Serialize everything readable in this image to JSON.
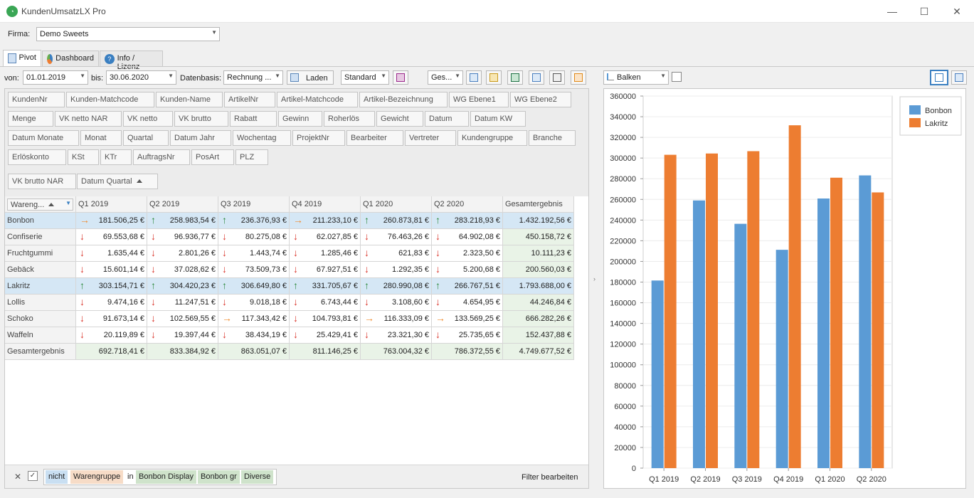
{
  "window": {
    "title": "KundenUmsatzLX Pro",
    "minimize": "—",
    "maximize": "☐",
    "close": "✕"
  },
  "firma": {
    "label": "Firma:",
    "value": "Demo Sweets"
  },
  "tabs": [
    {
      "label": "Pivot"
    },
    {
      "label": "Dashboard"
    },
    {
      "label": "Info / Lizenz"
    }
  ],
  "toolbar": {
    "von_label": "von:",
    "von_value": "01.01.2019",
    "bis_label": "bis:",
    "bis_value": "30.06.2020",
    "datenbasis_label": "Datenbasis:",
    "datenbasis_value": "Rechnung ...",
    "laden_label": "Laden",
    "layout_value": "Standard",
    "ges_value": "Ges..."
  },
  "field_buttons": [
    [
      "KundenNr",
      "Kunden-Matchcode",
      "Kunden-Name",
      "ArtikelNr",
      "Artikel-Matchcode",
      "Artikel-Bezeichnung",
      "WG Ebene1",
      "WG Ebene2"
    ],
    [
      "Menge",
      "VK netto NAR",
      "VK netto",
      "VK brutto",
      "Rabatt",
      "Gewinn",
      "Roherlös",
      "Gewicht",
      "Datum",
      "Datum KW"
    ],
    [
      "Datum Monate",
      "Monat",
      "Quartal",
      "Datum Jahr",
      "Wochentag",
      "ProjektNr",
      "Bearbeiter",
      "Vertreter",
      "Kundengruppe",
      "Branche"
    ],
    [
      "Erlöskonto",
      "KSt",
      "KTr",
      "AuftragsNr",
      "PosArt",
      "PLZ"
    ]
  ],
  "data_field": "VK brutto NAR",
  "column_field": "Datum Quartal",
  "row_field": "Wareng...",
  "grid": {
    "columns": [
      "Q1 2019",
      "Q2 2019",
      "Q3 2019",
      "Q4 2019",
      "Q1 2020",
      "Q2 2020",
      "Gesamtergebnis"
    ],
    "rows": [
      {
        "name": "Bonbon",
        "hl": true,
        "cells": [
          [
            "right",
            "181.506,25 €"
          ],
          [
            "up",
            "258.983,54 €"
          ],
          [
            "up",
            "236.376,93 €"
          ],
          [
            "right",
            "211.233,10 €"
          ],
          [
            "up",
            "260.873,81 €"
          ],
          [
            "up",
            "283.218,93 €"
          ]
        ],
        "total": "1.432.192,56 €"
      },
      {
        "name": "Confiserie",
        "hl": false,
        "cells": [
          [
            "down",
            "69.553,68 €"
          ],
          [
            "down",
            "96.936,77 €"
          ],
          [
            "down",
            "80.275,08 €"
          ],
          [
            "down",
            "62.027,85 €"
          ],
          [
            "down",
            "76.463,26 €"
          ],
          [
            "down",
            "64.902,08 €"
          ]
        ],
        "total": "450.158,72 €"
      },
      {
        "name": "Fruchtgummi",
        "hl": false,
        "cells": [
          [
            "down",
            "1.635,44 €"
          ],
          [
            "down",
            "2.801,26 €"
          ],
          [
            "down",
            "1.443,74 €"
          ],
          [
            "down",
            "1.285,46 €"
          ],
          [
            "down",
            "621,83 €"
          ],
          [
            "down",
            "2.323,50 €"
          ]
        ],
        "total": "10.111,23 €"
      },
      {
        "name": "Gebäck",
        "hl": false,
        "cells": [
          [
            "down",
            "15.601,14 €"
          ],
          [
            "down",
            "37.028,62 €"
          ],
          [
            "down",
            "73.509,73 €"
          ],
          [
            "down",
            "67.927,51 €"
          ],
          [
            "down",
            "1.292,35 €"
          ],
          [
            "down",
            "5.200,68 €"
          ]
        ],
        "total": "200.560,03 €"
      },
      {
        "name": "Lakritz",
        "hl": true,
        "cells": [
          [
            "up",
            "303.154,71 €"
          ],
          [
            "up",
            "304.420,23 €"
          ],
          [
            "up",
            "306.649,80 €"
          ],
          [
            "up",
            "331.705,67 €"
          ],
          [
            "up",
            "280.990,08 €"
          ],
          [
            "up",
            "266.767,51 €"
          ]
        ],
        "total": "1.793.688,00 €"
      },
      {
        "name": "Lollis",
        "hl": false,
        "cells": [
          [
            "down",
            "9.474,16 €"
          ],
          [
            "down",
            "11.247,51 €"
          ],
          [
            "down",
            "9.018,18 €"
          ],
          [
            "down",
            "6.743,44 €"
          ],
          [
            "down",
            "3.108,60 €"
          ],
          [
            "down",
            "4.654,95 €"
          ]
        ],
        "total": "44.246,84 €"
      },
      {
        "name": "Schoko",
        "hl": false,
        "cells": [
          [
            "down",
            "91.673,14 €"
          ],
          [
            "down",
            "102.569,55 €"
          ],
          [
            "right",
            "117.343,42 €"
          ],
          [
            "down",
            "104.793,81 €"
          ],
          [
            "right",
            "116.333,09 €"
          ],
          [
            "right",
            "133.569,25 €"
          ]
        ],
        "total": "666.282,26 €"
      },
      {
        "name": "Waffeln",
        "hl": false,
        "cells": [
          [
            "down",
            "20.119,89 €"
          ],
          [
            "down",
            "19.397,44 €"
          ],
          [
            "down",
            "38.434,19 €"
          ],
          [
            "down",
            "25.429,41 €"
          ],
          [
            "down",
            "23.321,30 €"
          ],
          [
            "down",
            "25.735,65 €"
          ]
        ],
        "total": "152.437,88 €"
      }
    ],
    "total_row": {
      "name": "Gesamtergebnis",
      "cells": [
        "692.718,41 €",
        "833.384,92 €",
        "863.051,07 €",
        "811.146,25 €",
        "763.004,32 €",
        "786.372,55 €"
      ],
      "total": "4.749.677,52 €"
    }
  },
  "filter": {
    "close": "✕",
    "check": "✓",
    "not": "nicht",
    "field": "Warengruppe",
    "in": "in",
    "values": [
      "Bonbon Display",
      "Bonbon gr",
      "Diverse"
    ],
    "edit": "Filter bearbeiten"
  },
  "chart_type_value": "Balken",
  "chart_data": {
    "type": "bar",
    "categories": [
      "Q1 2019",
      "Q2 2019",
      "Q3 2019",
      "Q4 2019",
      "Q1 2020",
      "Q2 2020"
    ],
    "series": [
      {
        "name": "Bonbon",
        "color": "#5b9bd5",
        "values": [
          181506.25,
          258983.54,
          236376.93,
          211233.1,
          260873.81,
          283218.93
        ]
      },
      {
        "name": "Lakritz",
        "color": "#ed7d31",
        "values": [
          303154.71,
          304420.23,
          306649.8,
          331705.67,
          280990.08,
          266767.51
        ]
      }
    ],
    "ylim": [
      0,
      360000
    ],
    "yticks": [
      0,
      20000,
      40000,
      60000,
      80000,
      100000,
      120000,
      140000,
      160000,
      180000,
      200000,
      220000,
      240000,
      260000,
      280000,
      300000,
      320000,
      340000,
      360000
    ],
    "grid": true,
    "legend": "top-right"
  }
}
